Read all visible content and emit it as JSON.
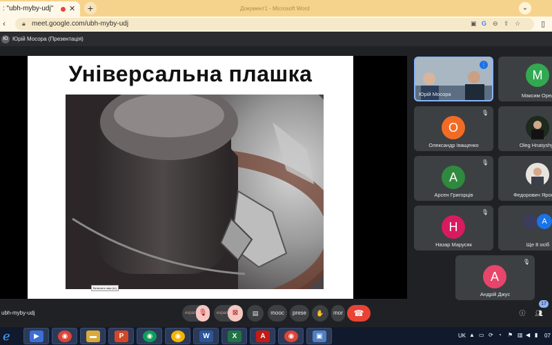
{
  "browser": {
    "tab_title": ": \"ubh-myby-udj\"",
    "tab_close": "✕",
    "new_tab": "+",
    "window_title": "Документ1 - Microsoft Word",
    "url": "meet.google.com/ubh-myby-udj",
    "back": "‹",
    "chevron": "⌄"
  },
  "meet": {
    "presenter_label": "Юрій Мосора (Презентація)",
    "slide_title": "Універсальна плашка",
    "tooltip": "Включить звук (m)",
    "meeting_code": "ubh-myby-udj",
    "participants_count": "17",
    "more_people": "Ще 8 осіб",
    "tiles": [
      {
        "name": "Юрій Мосора",
        "letter": "",
        "color": "#5a6b7a"
      },
      {
        "name": "Максим Орел",
        "letter": "M",
        "color": "#33a852"
      },
      {
        "name": "Олександр Іващенко",
        "letter": "O",
        "color": "#f26b25"
      },
      {
        "name": "Oleg Hnatyshyn",
        "letter": "",
        "color": "#223322"
      },
      {
        "name": "Арсен Григорців",
        "letter": "A",
        "color": "#2f8a3e"
      },
      {
        "name": "Федорович Ярослав",
        "letter": "",
        "color": "#8a8a8a"
      },
      {
        "name": "Назар Марусяк",
        "letter": "H",
        "color": "#d81b60"
      },
      {
        "name": "Андрій Джус",
        "letter": "A",
        "color": "#e8456b"
      }
    ],
    "controls": {
      "mic_label": "expan",
      "cam_label": "expan",
      "captions_label": "mooc",
      "present_label": "prese",
      "hand_icon": "✋",
      "more_label": "mor",
      "leave_icon": "☎"
    }
  },
  "taskbar": {
    "lang": "UK",
    "clock": "07"
  }
}
